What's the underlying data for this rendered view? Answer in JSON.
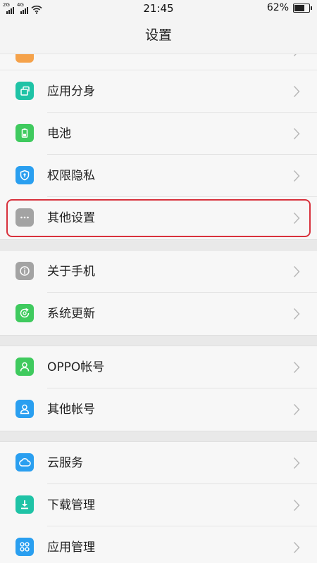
{
  "status_bar": {
    "sim1_label": "2G",
    "sim2_label": "4G",
    "time": "21:45",
    "battery_percent": "62%",
    "battery_level": 0.62
  },
  "header": {
    "title": "设置"
  },
  "groups": [
    {
      "items": [
        {
          "label": "应用分身",
          "icon": "app-clone-icon",
          "color": "#1fc3a6"
        },
        {
          "label": "电池",
          "icon": "battery-icon",
          "color": "#3fca5e"
        },
        {
          "label": "权限隐私",
          "icon": "privacy-shield-icon",
          "color": "#2a9ff0"
        },
        {
          "label": "其他设置",
          "icon": "more-dots-icon",
          "color": "#a3a3a3",
          "highlighted": true
        }
      ]
    },
    {
      "items": [
        {
          "label": "关于手机",
          "icon": "info-icon",
          "color": "#a3a3a3"
        },
        {
          "label": "系统更新",
          "icon": "system-update-icon",
          "color": "#3fca5e"
        }
      ]
    },
    {
      "items": [
        {
          "label": "OPPO帐号",
          "icon": "oppo-account-icon",
          "color": "#3fca5e"
        },
        {
          "label": "其他帐号",
          "icon": "other-account-icon",
          "color": "#2a9ff0"
        }
      ]
    },
    {
      "items": [
        {
          "label": "云服务",
          "icon": "cloud-icon",
          "color": "#2a9ff0"
        },
        {
          "label": "下载管理",
          "icon": "download-icon",
          "color": "#1fc3a6"
        },
        {
          "label": "应用管理",
          "icon": "app-management-icon",
          "color": "#2a9ff0"
        }
      ]
    }
  ]
}
